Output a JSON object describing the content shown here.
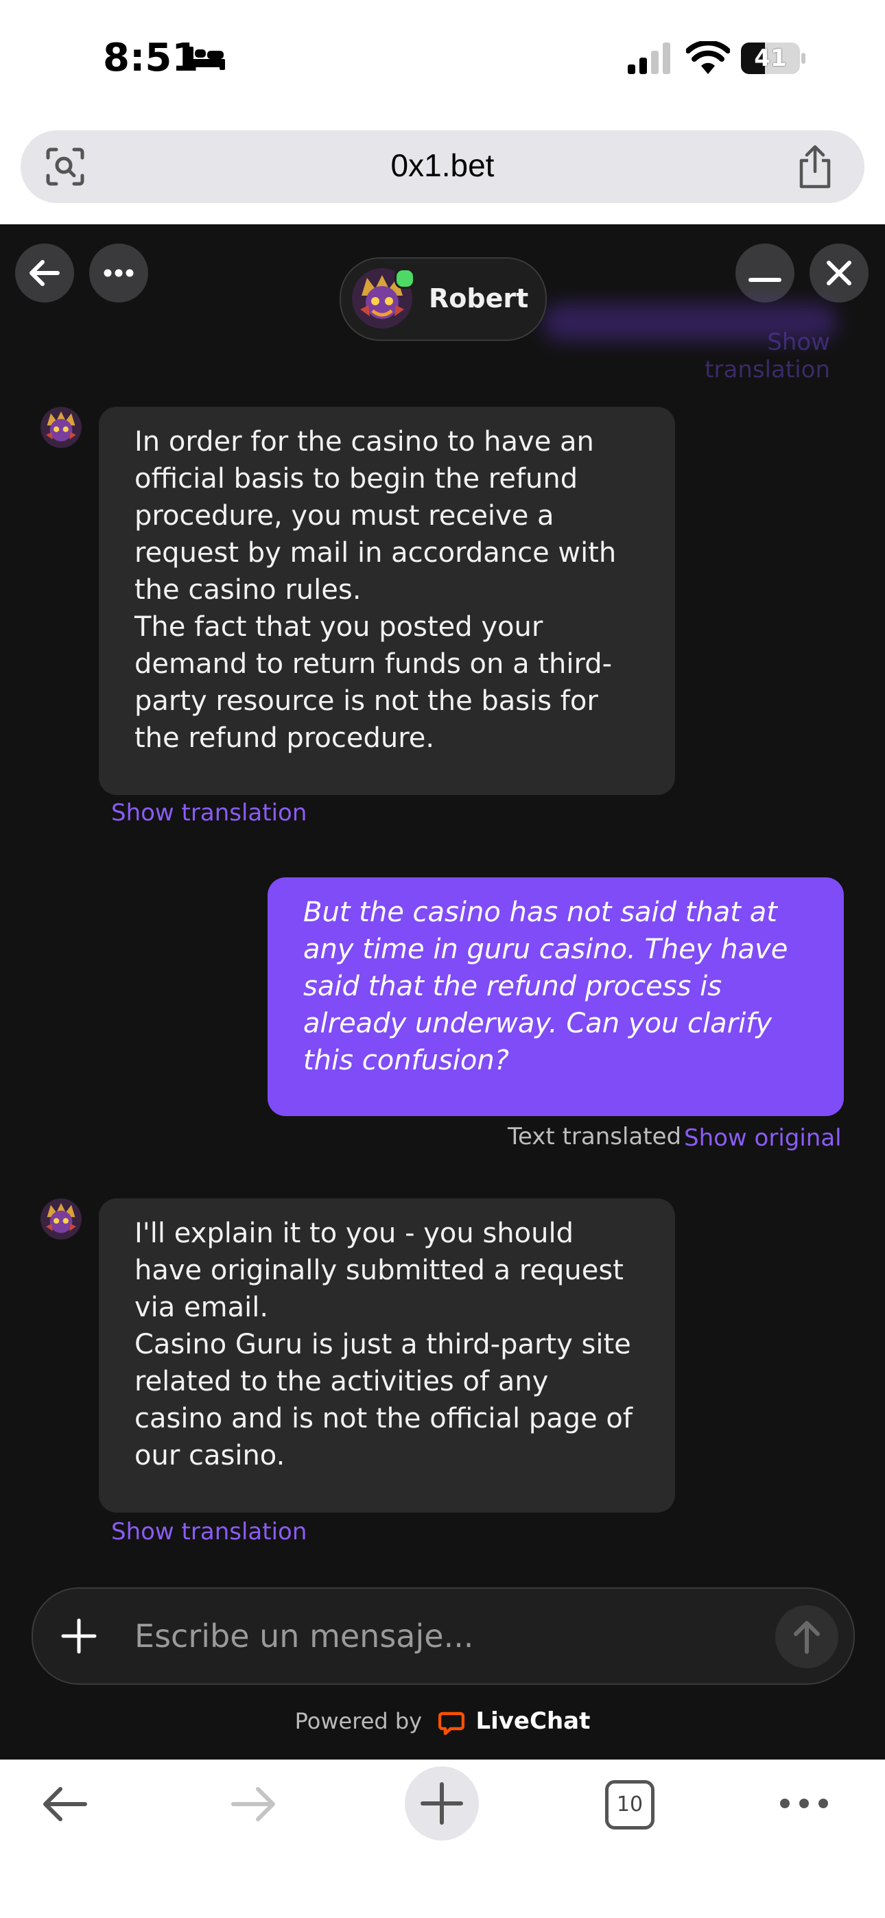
{
  "status_bar": {
    "time": "8:51",
    "battery": "41"
  },
  "browser": {
    "url": "0x1.bet"
  },
  "chat": {
    "agent_name": "Robert",
    "faded_translation": "Show translation",
    "messages": [
      {
        "from": "agent",
        "text": "In order for the casino to have an official basis to begin the refund procedure, you must receive a request by mail in accordance with the casino rules.\nThe fact that you posted your demand to return funds on a third-party resource is not the basis for the refund procedure.",
        "link": "Show translation"
      },
      {
        "from": "user",
        "text": "But the casino has not said that at any time in guru casino. They have said that the refund process is already underway. Can you clarify this confusion?",
        "meta": "Text translated",
        "link": "Show original"
      },
      {
        "from": "agent",
        "text": "I'll explain it to you - you should have originally submitted a request via email.\nCasino Guru is just a third-party site related to the activities of any casino and is not the official page of our casino.",
        "link": "Show translation"
      }
    ],
    "composer": {
      "placeholder": "Escribe un mensaje..."
    },
    "powered_by": {
      "label": "Powered by",
      "brand": "LiveChat"
    }
  },
  "toolbar": {
    "tab_count": "10"
  },
  "colors": {
    "accent": "#8b5cf6",
    "user_bubble": "#7f4cf7",
    "chat_bg": "#121212",
    "agent_bubble": "#2a2a2a",
    "online": "#4cd964"
  }
}
